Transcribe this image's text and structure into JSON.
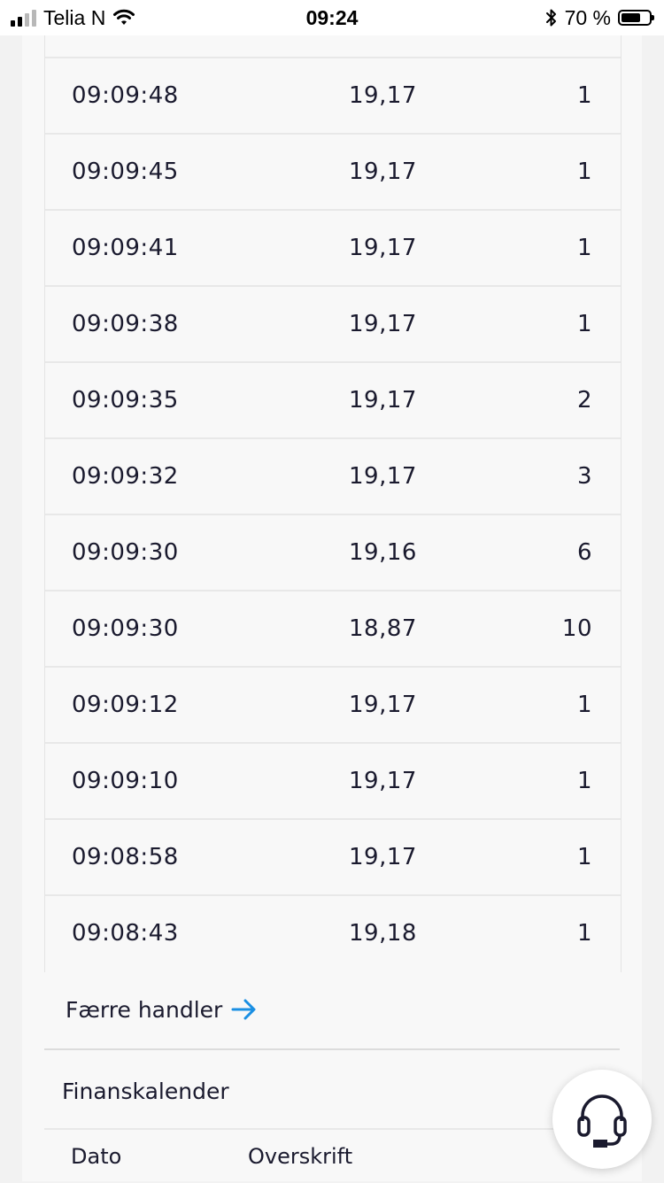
{
  "status_bar": {
    "carrier": "Telia N",
    "time": "09:24",
    "battery_text": "70 %",
    "battery_level": 0.7,
    "icons": [
      "signal-icon",
      "wifi-icon",
      "bluetooth-icon",
      "battery-icon"
    ]
  },
  "trades": [
    {
      "time": "09:09:48",
      "price": "19,17",
      "volume": "1"
    },
    {
      "time": "09:09:45",
      "price": "19,17",
      "volume": "1"
    },
    {
      "time": "09:09:41",
      "price": "19,17",
      "volume": "1"
    },
    {
      "time": "09:09:38",
      "price": "19,17",
      "volume": "1"
    },
    {
      "time": "09:09:35",
      "price": "19,17",
      "volume": "2"
    },
    {
      "time": "09:09:32",
      "price": "19,17",
      "volume": "3"
    },
    {
      "time": "09:09:30",
      "price": "19,16",
      "volume": "6"
    },
    {
      "time": "09:09:30",
      "price": "18,87",
      "volume": "10"
    },
    {
      "time": "09:09:12",
      "price": "19,17",
      "volume": "1"
    },
    {
      "time": "09:09:10",
      "price": "19,17",
      "volume": "1"
    },
    {
      "time": "09:08:58",
      "price": "19,17",
      "volume": "1"
    },
    {
      "time": "09:08:43",
      "price": "19,18",
      "volume": "1"
    }
  ],
  "fewer_trades_link": {
    "label": "Færre handler",
    "icon": "arrow-right-icon",
    "color": "#1a8fe3"
  },
  "finance_calendar": {
    "title": "Finanskalender",
    "columns": {
      "date": "Dato",
      "heading": "Overskrift"
    }
  },
  "support": {
    "icon": "headset-icon"
  }
}
